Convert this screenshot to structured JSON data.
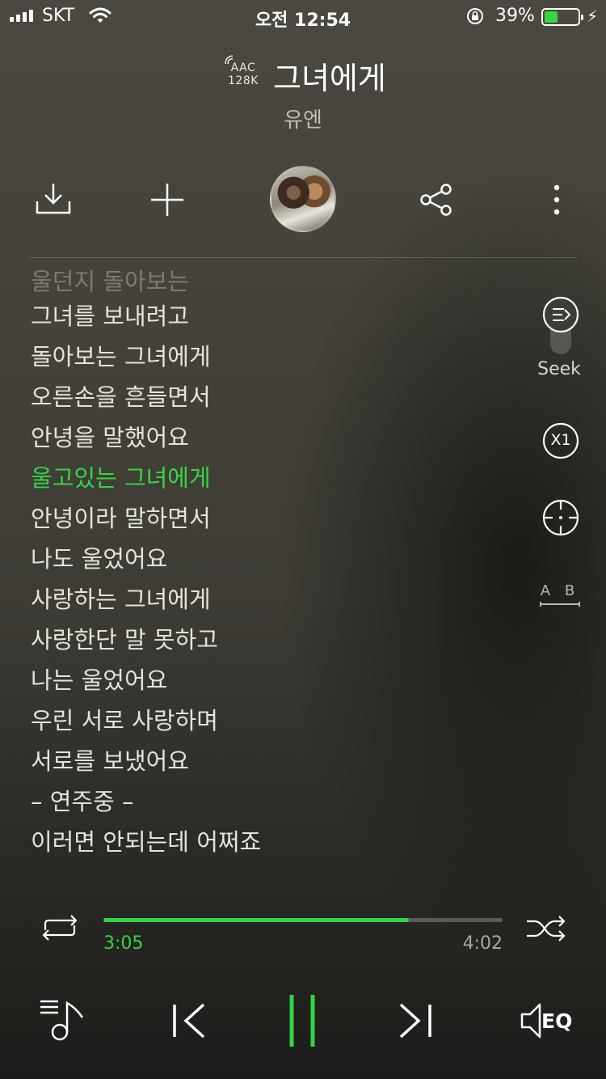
{
  "status_bar": {
    "carrier": "SKT",
    "time": "오전 12:54",
    "battery_percent": "39%",
    "battery_level": 0.39
  },
  "codec": {
    "line1": "AAC",
    "line2": "128K"
  },
  "song": {
    "title": "그녀에게",
    "artist": "유엔"
  },
  "lyrics": [
    {
      "text": "울던지 돌아보는",
      "state": "faded"
    },
    {
      "text": "그녀를 보내려고",
      "state": "normal"
    },
    {
      "text": "돌아보는 그녀에게",
      "state": "normal"
    },
    {
      "text": "오른손을 흔들면서",
      "state": "normal"
    },
    {
      "text": "안녕을 말했어요",
      "state": "normal"
    },
    {
      "text": "울고있는 그녀에게",
      "state": "active"
    },
    {
      "text": "안녕이라 말하면서",
      "state": "normal"
    },
    {
      "text": "나도 울었어요",
      "state": "normal"
    },
    {
      "text": "사랑하는 그녀에게",
      "state": "normal"
    },
    {
      "text": "사랑한단 말 못하고",
      "state": "normal"
    },
    {
      "text": "나는 울었어요",
      "state": "normal"
    },
    {
      "text": "우린 서로 사랑하며",
      "state": "normal"
    },
    {
      "text": "서로를 보냈어요",
      "state": "normal"
    },
    {
      "text": "– 연주중 –",
      "state": "normal"
    },
    {
      "text": "이러면 안되는데 어쩌죠",
      "state": "normal"
    }
  ],
  "side_controls": {
    "seek_label": "Seek",
    "speed_label": "X1",
    "ab_label": "A B"
  },
  "playback": {
    "elapsed": "3:05",
    "total": "4:02",
    "progress": 0.7645
  },
  "bottom_controls": {
    "eq_label": "EQ"
  },
  "colors": {
    "accent": "#33d544",
    "text": "#e4e3dd",
    "muted": "#a9a8a2"
  }
}
